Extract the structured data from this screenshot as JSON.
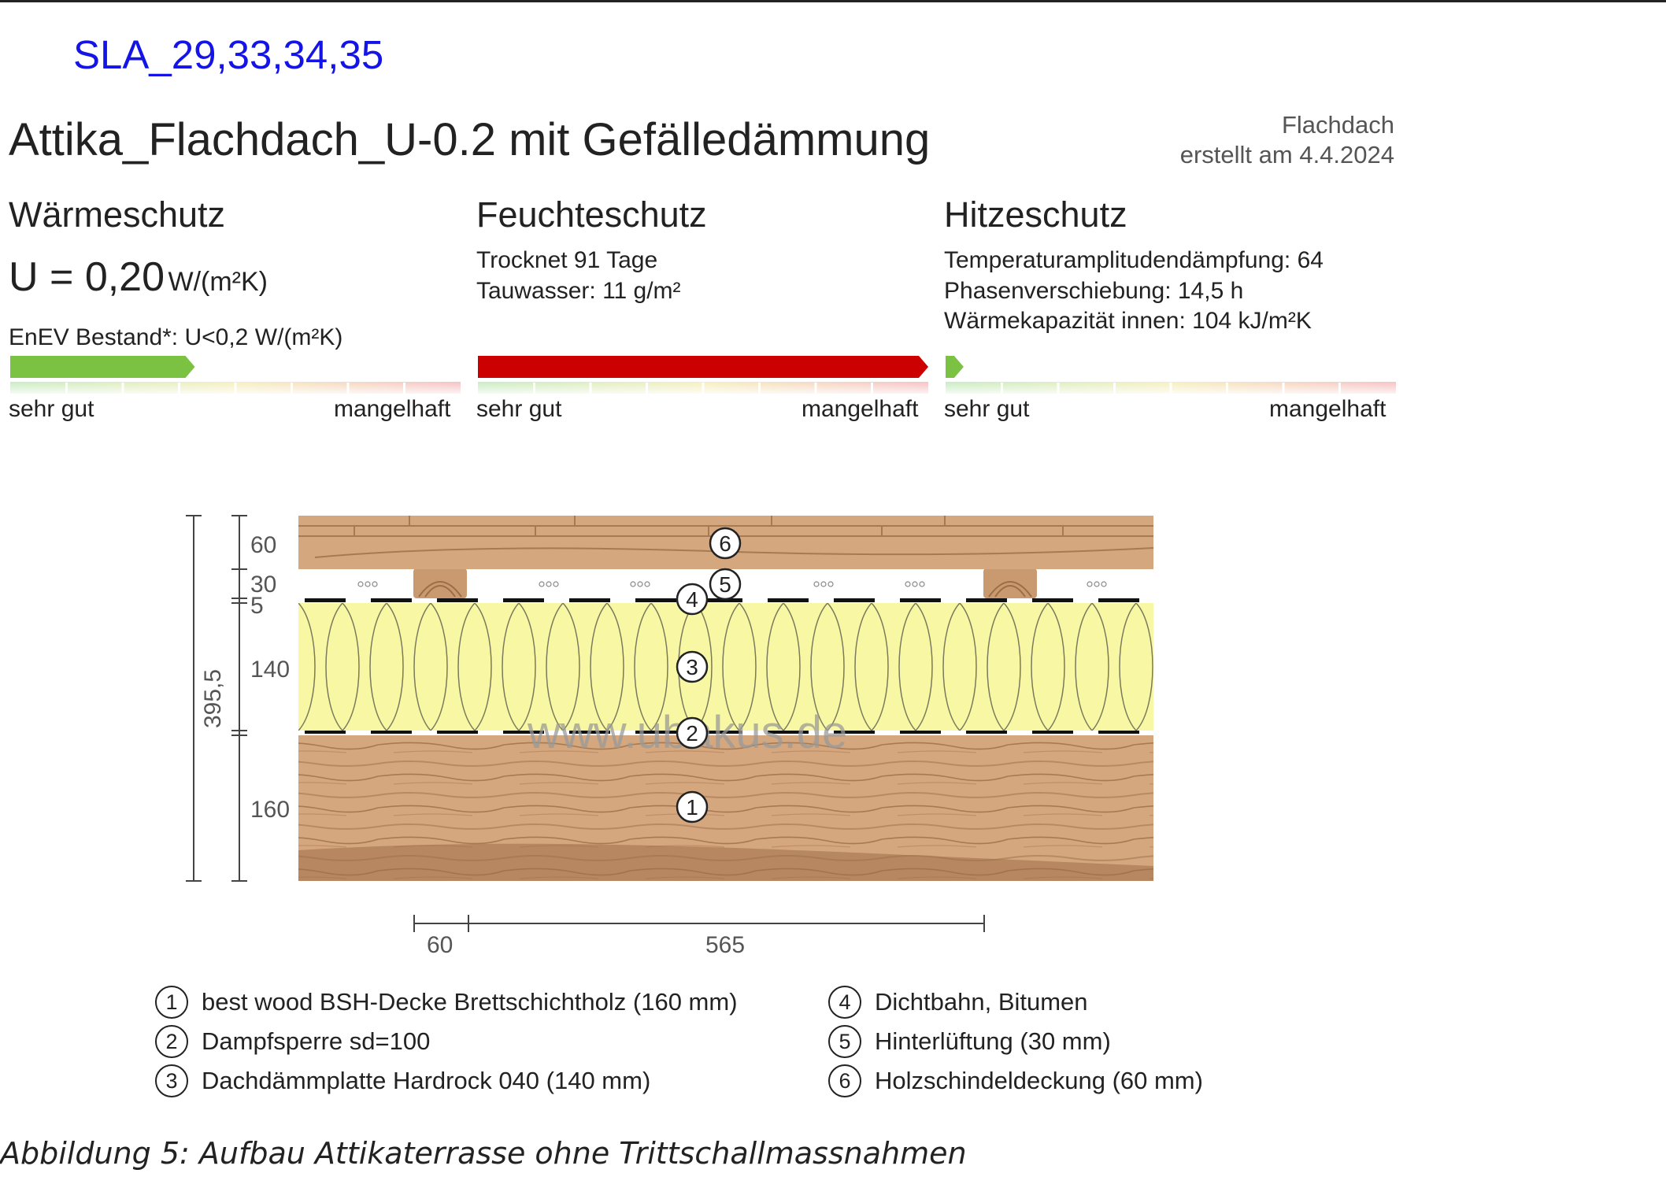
{
  "reference": "SLA_29,33,34,35",
  "title": "Attika_Flachdach_U-0.2 mit Gefälledämmung",
  "meta": {
    "category": "Flachdach",
    "created": "erstellt am 4.4.2024"
  },
  "sections": {
    "waermeschutz": {
      "heading": "Wärmeschutz",
      "u_prefix": "U = 0,20",
      "u_unit": "W/(m²K)",
      "requirement": "EnEV Bestand*: U<0,2 W/(m²K)",
      "rating": 0.41,
      "rating_color": "#7cc242",
      "left_label": "sehr gut",
      "right_label": "mangelhaft"
    },
    "feuchteschutz": {
      "heading": "Feuchteschutz",
      "line1": "Trocknet 91 Tage",
      "line2": "Tauwasser: 11 g/m²",
      "rating": 1.0,
      "rating_color": "#cc0000",
      "left_label": "sehr gut",
      "right_label": "mangelhaft"
    },
    "hitzeschutz": {
      "heading": "Hitzeschutz",
      "line1": "Temperaturamplitudendämpfung: 64",
      "line2": "Phasenverschiebung: 14,5 h",
      "line3": "Wärmekapazität innen: 104 kJ/m²K",
      "rating": 0.04,
      "rating_color": "#7cc242",
      "left_label": "sehr gut",
      "right_label": "mangelhaft"
    }
  },
  "diagram": {
    "layer_thickness_labels": [
      "60",
      "30",
      "5",
      "140",
      "160"
    ],
    "total_thickness": "395,5",
    "width_labels": [
      "60",
      "565"
    ],
    "watermark": "www.ubakus.de",
    "markers": [
      "1",
      "2",
      "3",
      "4",
      "5",
      "6"
    ]
  },
  "legend": [
    {
      "num": "1",
      "text": "best wood BSH-Decke Brettschichtholz (160 mm)"
    },
    {
      "num": "2",
      "text": "Dampfsperre sd=100"
    },
    {
      "num": "3",
      "text": "Dachdämmplatte Hardrock 040 (140 mm)"
    },
    {
      "num": "4",
      "text": "Dichtbahn, Bitumen"
    },
    {
      "num": "5",
      "text": "Hinterlüftung (30 mm)"
    },
    {
      "num": "6",
      "text": "Holzschindeldeckung (60 mm)"
    }
  ],
  "caption": "Abbildung 5: Aufbau Attikaterrasse ohne Trittschallmassnahmen",
  "colors": {
    "reference": "#1414e6",
    "wood": "#d4a77f",
    "insulation": "#f8f7a3",
    "grid_good": "#c9ecc4",
    "grid_bad": "#f6c2c6"
  }
}
